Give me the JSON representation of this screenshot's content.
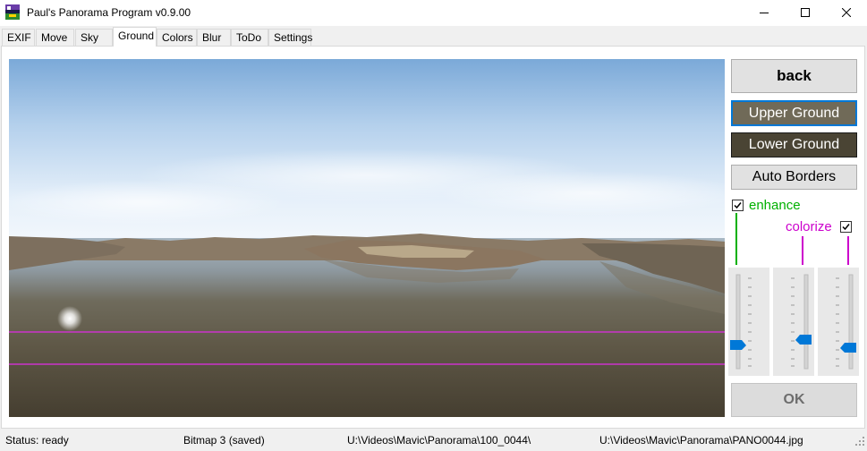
{
  "window": {
    "title": "Paul's Panorama Program v0.9.00",
    "minimize_icon": "minimize-icon",
    "maximize_icon": "maximize-icon",
    "close_icon": "close-icon"
  },
  "tabs": [
    {
      "label": "EXIF"
    },
    {
      "label": "Move"
    },
    {
      "label": "Sky"
    },
    {
      "label": "Ground"
    },
    {
      "label": "Colors"
    },
    {
      "label": "Blur"
    },
    {
      "label": "ToDo"
    },
    {
      "label": "Settings"
    }
  ],
  "active_tab": "Ground",
  "buttons": {
    "back": "back",
    "upper_ground": "Upper Ground",
    "lower_ground": "Lower Ground",
    "auto_borders": "Auto Borders",
    "ok": "OK"
  },
  "colors": {
    "upper_ground": "#706a58",
    "lower_ground": "#4a4434",
    "enhance": "#00b000",
    "colorize": "#cc00cc",
    "border_line": "#cc33cc",
    "slider_thumb": "#0078d7"
  },
  "checkboxes": {
    "enhance": {
      "label": "enhance",
      "checked": true
    },
    "colorize": {
      "label": "colorize",
      "checked": true
    }
  },
  "sliders": {
    "slider1": {
      "value": 0.2
    },
    "slider2": {
      "value": 0.35
    },
    "slider3": {
      "value": 0.2
    }
  },
  "status": {
    "state": "Status: ready",
    "bitmap": "Bitmap 3 (saved)",
    "folder": "U:\\Videos\\Mavic\\Panorama\\100_0044\\",
    "file": "U:\\Videos\\Mavic\\Panorama\\PANO0044.jpg"
  }
}
